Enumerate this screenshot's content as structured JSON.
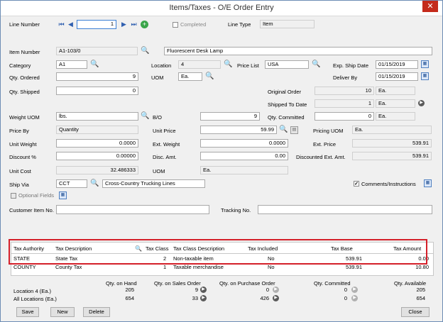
{
  "window": {
    "title": "Items/Taxes - O/E Order Entry",
    "close": "✕"
  },
  "top": {
    "line_number_label": "Line Number",
    "line_number_value": "1",
    "completed_label": "Completed",
    "line_type_label": "Line Type",
    "line_type_value": "Item"
  },
  "item": {
    "item_number_label": "Item Number",
    "item_number_value": "A1-103/0",
    "description": "Fluorescent Desk Lamp",
    "category_label": "Category",
    "category_value": "A1",
    "location_label": "Location",
    "location_value": "4",
    "price_list_label": "Price List",
    "price_list_value": "USA",
    "exp_ship_date_label": "Exp. Ship Date",
    "exp_ship_date_value": "01/15/2019",
    "qty_ordered_label": "Qty. Ordered",
    "qty_ordered_value": "9",
    "uom_label": "UOM",
    "uom_value": "Ea.",
    "deliver_by_label": "Deliver By",
    "deliver_by_value": "01/15/2019",
    "qty_shipped_label": "Qty. Shipped",
    "qty_shipped_value": "0",
    "original_order_label": "Original Order",
    "original_order_value": "10",
    "original_order_uom": "Ea.",
    "shipped_to_date_label": "Shipped To Date",
    "shipped_to_date_value": "1",
    "shipped_to_date_uom": "Ea.",
    "weight_uom_label": "Weight UOM",
    "weight_uom_value": "lbs.",
    "bo_label": "B/O",
    "bo_value": "9",
    "qty_committed_label": "Qty. Committed",
    "qty_committed_value": "0",
    "qty_committed_uom": "Ea.",
    "price_by_label": "Price By",
    "price_by_value": "Quantity",
    "unit_price_label": "Unit Price",
    "unit_price_value": "59.99",
    "pricing_uom_label": "Pricing UOM",
    "pricing_uom_value": "Ea.",
    "unit_weight_label": "Unit Weight",
    "unit_weight_value": "0.0000",
    "ext_weight_label": "Ext. Weight",
    "ext_weight_value": "0.0000",
    "ext_price_label": "Ext. Price",
    "ext_price_value": "539.91",
    "discount_label": "Discount %",
    "discount_value": "0.00000",
    "disc_amt_label": "Disc. Amt.",
    "disc_amt_value": "0.00",
    "discounted_ext_amt_label": "Discounted Ext. Amt.",
    "discounted_ext_amt_value": "539.91",
    "unit_cost_label": "Unit Cost",
    "unit_cost_value": "32.486333",
    "uom2_label": "UOM",
    "uom2_value": "Ea.",
    "ship_via_label": "Ship Via",
    "ship_via_value": "CCT",
    "ship_via_desc": "Cross-Country Trucking Lines",
    "comments_label": "Comments/Instructions",
    "optional_fields_label": "Optional Fields",
    "customer_item_label": "Customer Item No.",
    "tracking_label": "Tracking No."
  },
  "tax_table": {
    "headers": [
      "Tax Authority",
      "Tax Description",
      "Tax Class",
      "Tax Class Description",
      "Tax Included",
      "Tax Base",
      "Tax Amount"
    ],
    "rows": [
      [
        "STATE",
        "State Tax",
        "2",
        "Non-taxable item",
        "No",
        "539.91",
        "0.00"
      ],
      [
        "COUNTY",
        "County Tax",
        "1",
        "Taxable merchandise",
        "No",
        "539.91",
        "10.80"
      ]
    ]
  },
  "summary": {
    "headers": [
      "Qty. on Hand",
      "Qty. on Sales Order",
      "Qty. on Purchase Order",
      "Qty. Committed",
      "Qty. Available"
    ],
    "location_label": "Location  4 (Ea.)",
    "location_values": [
      "205",
      "9",
      "0",
      "0",
      "205"
    ],
    "all_label": "All Locations (Ea.)",
    "all_values": [
      "654",
      "33",
      "426",
      "0",
      "654"
    ]
  },
  "buttons": {
    "save": "Save",
    "new": "New",
    "delete": "Delete",
    "close": "Close"
  }
}
